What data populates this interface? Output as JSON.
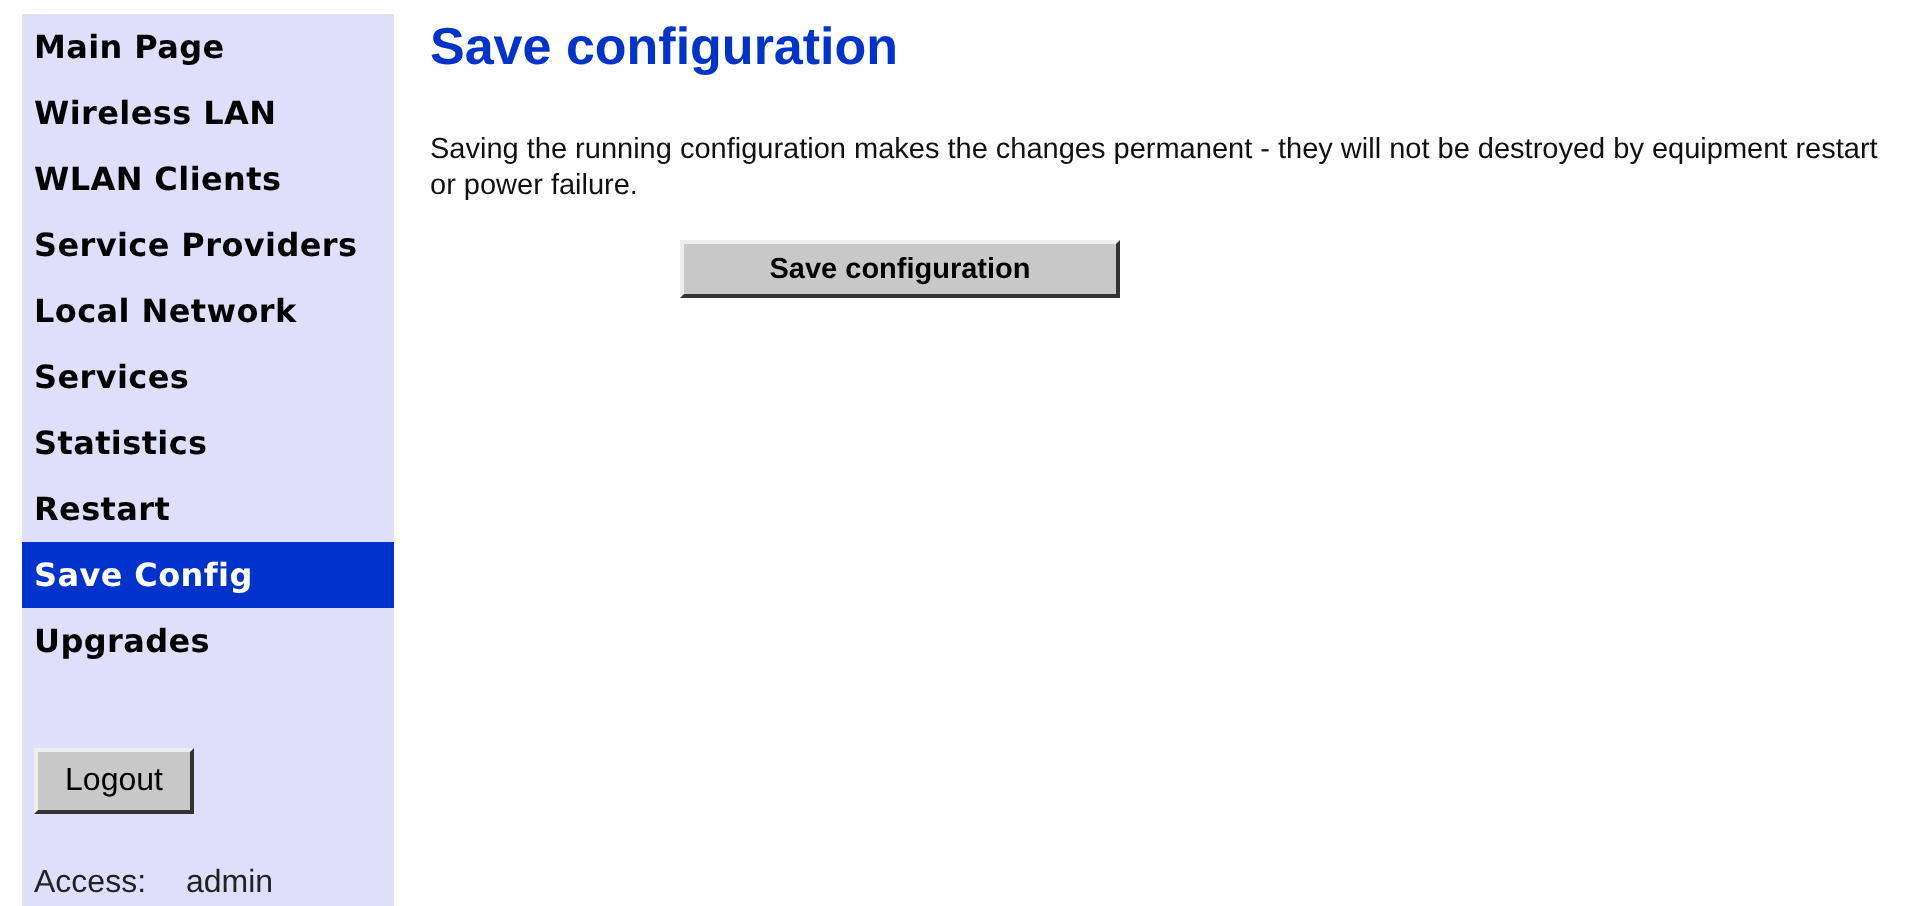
{
  "sidebar": {
    "items": [
      {
        "label": "Main Page",
        "selected": false
      },
      {
        "label": "Wireless LAN",
        "selected": false
      },
      {
        "label": "WLAN Clients",
        "selected": false
      },
      {
        "label": "Service Providers",
        "selected": false
      },
      {
        "label": "Local Network",
        "selected": false
      },
      {
        "label": "Services",
        "selected": false
      },
      {
        "label": "Statistics",
        "selected": false
      },
      {
        "label": "Restart",
        "selected": false
      },
      {
        "label": "Save Config",
        "selected": true
      },
      {
        "label": "Upgrades",
        "selected": false
      }
    ],
    "logout_button": "Logout",
    "access": {
      "label": "Access:",
      "value": "admin"
    }
  },
  "main": {
    "title": "Save configuration",
    "description": "Saving the running configuration makes the changes permanent - they will not be destroyed by equipment restart or power failure.",
    "save_button": "Save configuration"
  }
}
